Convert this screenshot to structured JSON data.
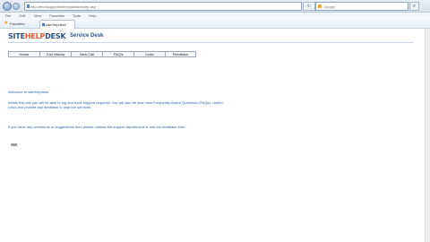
{
  "browser": {
    "url": "http://techsupport/sitehelpdesk/ep/ep.asp",
    "search_placeholder": "Google",
    "menu": [
      "File",
      "Edit",
      "View",
      "Favorites",
      "Tools",
      "Help"
    ],
    "favorites_label": "Favorites",
    "tab_title": "siteHelpdesk"
  },
  "header": {
    "logo_part1": "SITE",
    "logo_part2": "H",
    "logo_part3": "E",
    "logo_part4": "LP",
    "logo_part5": "DESK",
    "subtitle": "Service Desk"
  },
  "nav": [
    "Home",
    "Call History",
    "New Call",
    "FAQ's",
    "Links",
    "Feedback"
  ],
  "content": {
    "welcome": "Welcome to siteHelpdesk",
    "para1": "Within this site you will be able to log and track support requests. You will also be able view Frequently Asked Questions (FAQs), Useful Links and provide any feedback to improve services.",
    "para2": "If you have any comments or suggestions then please contact the support department or use the feedback form.",
    "footer_mark": "sss"
  },
  "colors": {
    "brand_blue": "#2c4f8a",
    "brand_orange": "#e45b2b",
    "link_blue": "#2f63a9"
  }
}
